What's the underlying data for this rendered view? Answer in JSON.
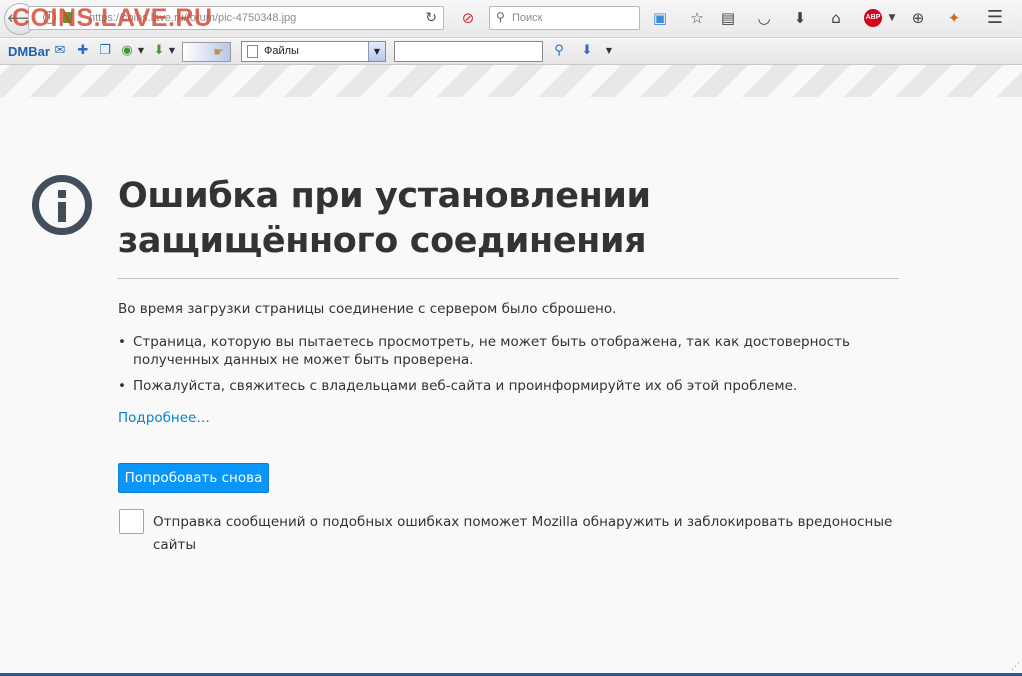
{
  "browser": {
    "url": "https://coins.lave.ru/forum/pic-4750348.jpg",
    "watermark": "COINS.LAVE.RU",
    "search_placeholder": "Поиск",
    "abp_label": "ABP"
  },
  "dmbar": {
    "label": "DMBar",
    "select_value": "Файлы"
  },
  "error": {
    "title": "Ошибка при установлении защищённого соединения",
    "intro": "Во время загрузки страницы соединение с сервером было сброшено.",
    "bullets": [
      "Страница, которую вы пытаетесь просмотреть, не может быть отображена, так как достоверность полученных данных не может быть проверена.",
      "Пожалуйста, свяжитесь с владельцами веб-сайта и проинформируйте их об этой проблеме."
    ],
    "more_link": "Подробнее…",
    "retry_button": "Попробовать снова",
    "report_label": "Отправка сообщений о подобных ошибках поможет Mozilla обнаружить и заблокировать вредоносные сайты"
  },
  "colors": {
    "accent_button": "#0996f8",
    "link": "#0a84c6",
    "icon_dark": "#424e5a",
    "watermark": "#d24632"
  }
}
